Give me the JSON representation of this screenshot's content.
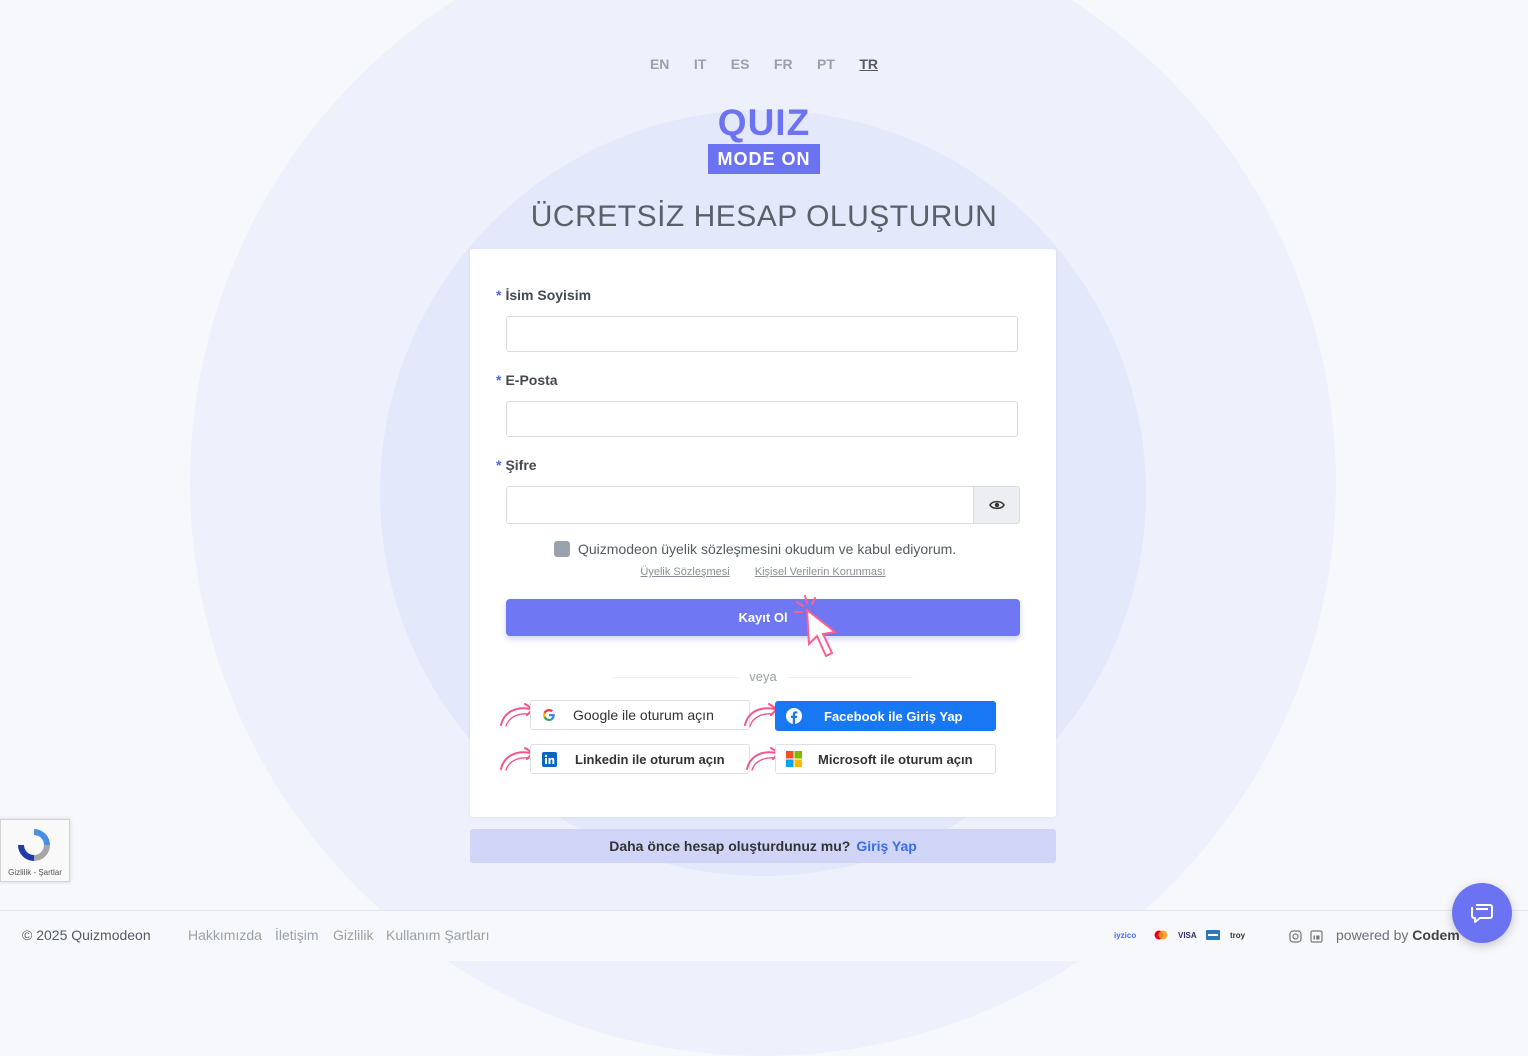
{
  "languages": [
    "EN",
    "IT",
    "ES",
    "FR",
    "PT",
    "TR"
  ],
  "active_language": "TR",
  "logo": {
    "top": "QUIZ",
    "bottom": "MODE ON"
  },
  "page_title": "ÜCRETSİZ HESAP OLUŞTURUN",
  "form": {
    "required_mark": "*",
    "name_label": "İsim Soyisim",
    "name_value": "",
    "email_label": "E-Posta",
    "email_value": "",
    "password_label": "Şifre",
    "password_value": "",
    "terms_text": "Quizmodeon üyelik sözleşmesini okudum ve kabul ediyorum.",
    "terms_checked": false,
    "terms_link_1": "Üyelik Sözleşmesi",
    "terms_link_2": "Kişisel Verilerin Korunması",
    "submit_label": "Kayıt Ol",
    "or_text": "veya"
  },
  "social": {
    "google": "Google ile oturum açın",
    "facebook": "Facebook ile Giriş Yap",
    "linkedin": "Linkedin ile oturum açın",
    "microsoft": "Microsoft ile oturum açın"
  },
  "login_prompt": {
    "text": "Daha önce hesap oluşturdunuz mu?",
    "link": "Giriş Yap"
  },
  "recaptcha": {
    "text": "Gizlilik - Şartlar"
  },
  "footer": {
    "copyright": "© 2025 Quizmodeon",
    "links": [
      "Hakkımızda",
      "İletişim",
      "Gizlilik",
      "Kullanım Şartları"
    ],
    "payment_icons": [
      "iyzico",
      "mastercard",
      "VISA",
      "amex",
      "troy"
    ],
    "social_icons": [
      "instagram-icon",
      "linkedin-icon"
    ],
    "powered_by_prefix": "powered by",
    "powered_by_name": "Codem"
  },
  "colors": {
    "accent": "#6f78f2",
    "facebook": "#1877f2",
    "link": "#3b6cf0"
  }
}
